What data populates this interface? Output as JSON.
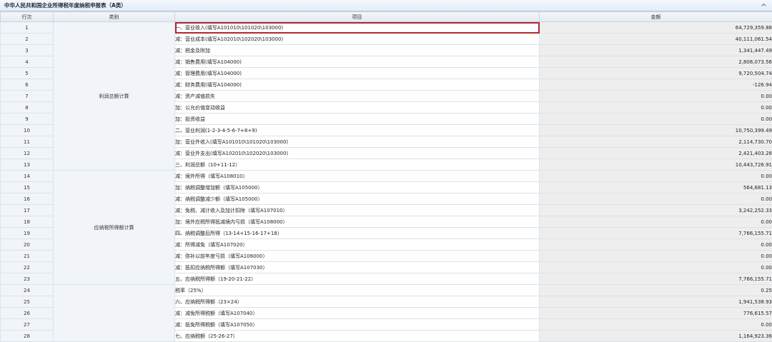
{
  "title": "中华人民共和国企业所得税年度纳税申报表（A类）",
  "columns": {
    "row_no": "行次",
    "category": "类别",
    "item": "项目",
    "amount": "金额"
  },
  "categories": {
    "profit": "利润总额计算",
    "taxable_income": "应纳税所得额计算",
    "tax": ""
  },
  "rows": [
    {
      "no": "1",
      "item": "一、营业收入(填写A101010\\101020\\103000)",
      "amount": "64,729,359.88"
    },
    {
      "no": "2",
      "item": "减：营业成本(填写A102010\\102020\\103000)",
      "amount": "40,111,061.54"
    },
    {
      "no": "3",
      "item": "减：税金及附加",
      "amount": "1,341,447.49"
    },
    {
      "no": "4",
      "item": "减：销售费用(填写A104000)",
      "amount": "2,806,073.56"
    },
    {
      "no": "5",
      "item": "减：管理费用(填写A104000)",
      "amount": "9,720,504.74"
    },
    {
      "no": "6",
      "item": "减：财务费用(填写A104000)",
      "amount": "-126.94"
    },
    {
      "no": "7",
      "item": "减：资产减值损失",
      "amount": "0.00"
    },
    {
      "no": "8",
      "item": "加：公允价值变动收益",
      "amount": "0.00"
    },
    {
      "no": "9",
      "item": "加：投资收益",
      "amount": "0.00"
    },
    {
      "no": "10",
      "item": "二、营业利润(1-2-3-4-5-6-7+8+9)",
      "amount": "10,750,399.49"
    },
    {
      "no": "11",
      "item": "加：营业外收入(填写A101010\\101020\\103000)",
      "amount": "2,114,730.70"
    },
    {
      "no": "12",
      "item": "减：营业外支出(填写A102010\\102020\\103000)",
      "amount": "2,421,403.28"
    },
    {
      "no": "13",
      "item": "三、利润总额（10+11-12）",
      "amount": "10,443,726.91"
    },
    {
      "no": "14",
      "item": "减：境外所得（填写A108010）",
      "amount": "0.00"
    },
    {
      "no": "15",
      "item": "加：纳税调整增加额（填写A105000）",
      "amount": "564,681.13"
    },
    {
      "no": "16",
      "item": "减：纳税调整减少额（填写A105000）",
      "amount": "0.00"
    },
    {
      "no": "17",
      "item": "减：免税、减计收入及加计扣除（填写A107010）",
      "amount": "3,242,252.33"
    },
    {
      "no": "18",
      "item": "加：境外应税所得抵减境内亏损（填写A108000）",
      "amount": "0.00"
    },
    {
      "no": "19",
      "item": "四、纳税调整后所得（13-14+15-16-17+18）",
      "amount": "7,766,155.71"
    },
    {
      "no": "20",
      "item": "减：所得减免（填写A107020）",
      "amount": "0.00"
    },
    {
      "no": "21",
      "item": "减：弥补以前年度亏损（填写A106000）",
      "amount": "0.00"
    },
    {
      "no": "22",
      "item": "减：抵扣应纳税所得额（填写A107030）",
      "amount": "0.00"
    },
    {
      "no": "23",
      "item": "五、应纳税所得额（19-20-21-22）",
      "amount": "7,766,155.71"
    },
    {
      "no": "24",
      "item": "税率（25%）",
      "amount": "0.25"
    },
    {
      "no": "25",
      "item": "六、应纳税所得额（23×24）",
      "amount": "1,941,538.93"
    },
    {
      "no": "26",
      "item": "减：减免所得税额（填写A107040）",
      "amount": "776,615.57"
    },
    {
      "no": "27",
      "item": "减：抵免所得税额（填写A107050）",
      "amount": "0.00"
    },
    {
      "no": "28",
      "item": "七、应纳税额（25-26-27）",
      "amount": "1,164,923.36"
    }
  ],
  "colors": {
    "highlight_border": "#b0282c",
    "header_bg": "#e4eaf1",
    "amount_bg": "#eeeeee"
  }
}
